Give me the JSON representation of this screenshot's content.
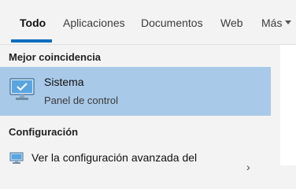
{
  "tabs": [
    {
      "label": "Todo",
      "active": true
    },
    {
      "label": "Aplicaciones",
      "active": false
    },
    {
      "label": "Documentos",
      "active": false
    },
    {
      "label": "Web",
      "active": false
    },
    {
      "label": "Más",
      "active": false
    }
  ],
  "results": {
    "best_match_header": "Mejor coincidencia",
    "best_match": {
      "title": "Sistema",
      "subtitle": "Panel de control",
      "icon": "computer-monitor-icon"
    },
    "settings_header": "Configuración",
    "settings_item": {
      "label": "Ver la configuración avanzada del",
      "icon": "monitor-settings-icon"
    }
  },
  "colors": {
    "accent": "#0f6cbd",
    "highlight": "#a9c9e8",
    "background": "#f3f3f3"
  }
}
